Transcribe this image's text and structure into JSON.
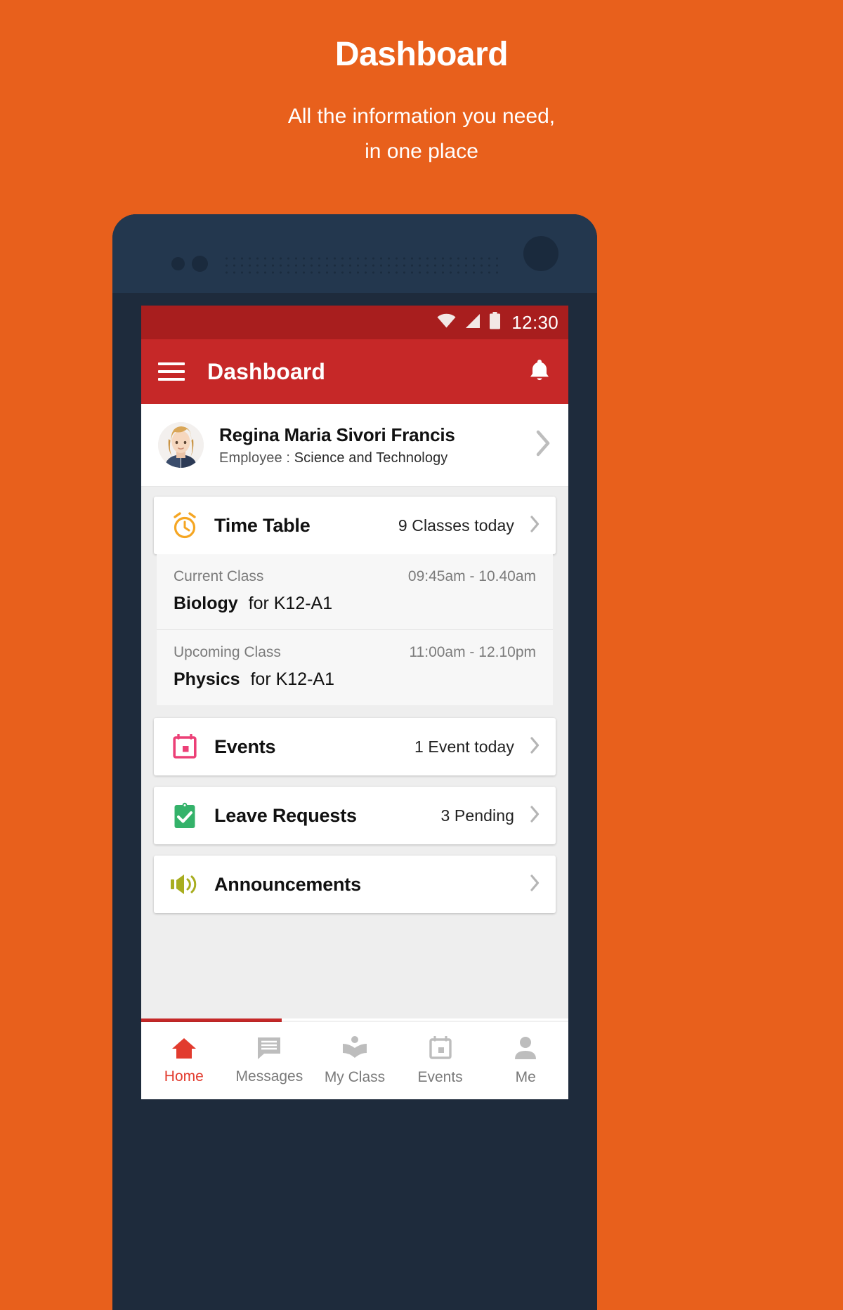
{
  "promo": {
    "title": "Dashboard",
    "subtitle_line1": "All the information you need,",
    "subtitle_line2": "in one place"
  },
  "colors": {
    "page_background": "#E8601C",
    "status_bar": "#A81E1E",
    "app_bar": "#C62828",
    "accent_red": "#E23B2E",
    "timetable_icon": "#F5A623",
    "events_icon": "#EC4077",
    "leave_icon": "#34B26A",
    "announcements_icon": "#A8AD1F",
    "phone_body": "#1E2B3C"
  },
  "status_bar": {
    "wifi_icon": "wifi-icon",
    "signal_icon": "signal-icon",
    "battery_icon": "battery-icon",
    "time": "12:30"
  },
  "app_bar": {
    "menu_icon": "hamburger-menu-icon",
    "title": "Dashboard",
    "notification_icon": "bell-icon"
  },
  "profile": {
    "avatar_icon": "user-avatar",
    "name": "Regina Maria Sivori Francis",
    "role_label": "Employee :",
    "department": "Science and Technology",
    "chevron_icon": "chevron-right-icon"
  },
  "cards": {
    "time_table": {
      "icon": "alarm-clock-icon",
      "label": "Time Table",
      "meta": "9 Classes today",
      "chevron_icon": "chevron-right-icon"
    },
    "events": {
      "icon": "calendar-icon",
      "label": "Events",
      "meta": "1 Event today",
      "chevron_icon": "chevron-right-icon"
    },
    "leave_requests": {
      "icon": "clipboard-check-icon",
      "label": "Leave Requests",
      "meta": "3 Pending",
      "chevron_icon": "chevron-right-icon"
    },
    "announcements": {
      "icon": "megaphone-icon",
      "label": "Announcements",
      "meta": "",
      "chevron_icon": "chevron-right-icon"
    }
  },
  "timetable_rows": [
    {
      "kind": "Current Class",
      "time": "09:45am - 10.40am",
      "subject": "Biology",
      "for": "for K12-A1"
    },
    {
      "kind": "Upcoming Class",
      "time": "11:00am - 12.10pm",
      "subject": "Physics",
      "for": "for K12-A1"
    }
  ],
  "bottom_nav": {
    "items": [
      {
        "label": "Home",
        "icon": "home-icon",
        "active": true
      },
      {
        "label": "Messages",
        "icon": "message-icon",
        "active": false
      },
      {
        "label": "My Class",
        "icon": "book-icon",
        "active": false
      },
      {
        "label": "Events",
        "icon": "calendar-icon",
        "active": false
      },
      {
        "label": "Me",
        "icon": "person-icon",
        "active": false
      }
    ]
  }
}
